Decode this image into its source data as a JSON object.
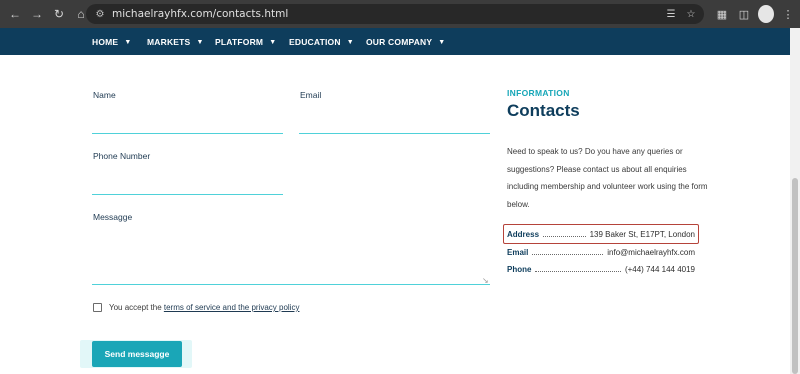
{
  "browser": {
    "url": "michaelrayhfx.com/contacts.html",
    "back_icon": "arrow-left",
    "forward_icon": "arrow-right",
    "reload_icon": "reload",
    "home_icon": "home"
  },
  "nav": {
    "items": [
      {
        "label": "HOME"
      },
      {
        "label": "MARKETS"
      },
      {
        "label": "PLATFORM"
      },
      {
        "label": "EDUCATION"
      },
      {
        "label": "OUR COMPANY"
      }
    ],
    "bg_color": "#0e3d5c"
  },
  "form": {
    "name_label": "Name",
    "email_label": "Email",
    "phone_label": "Phone Number",
    "message_label": "Messagge",
    "accept_prefix": "You accept the ",
    "accept_link": "terms of service and the privacy policy",
    "send_label": "Send messagge",
    "accent_color": "#4fd1d9",
    "button_color": "#1aa6b7"
  },
  "info": {
    "eyebrow": "INFORMATION",
    "title": "Contacts",
    "description": "Need to speak to us? Do you have any queries or suggestions? Please contact us about all enquiries including membership and volunteer work using the form below.",
    "address_key": "Address",
    "address_val": "139 Baker St, E17PT, London",
    "email_key": "Email",
    "email_val": "info@michaelrayhfx.com",
    "phone_key": "Phone",
    "phone_val": "(+44) 744 144 4019",
    "highlight_color": "#b5433a"
  }
}
